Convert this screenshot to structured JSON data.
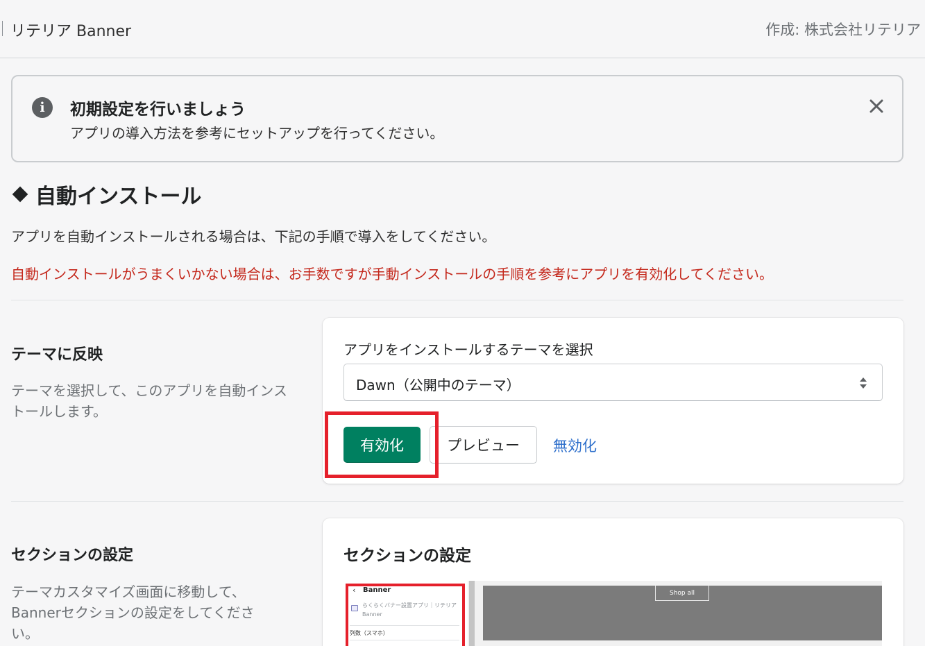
{
  "appbar": {
    "title": "リテリア Banner",
    "author": "作成: 株式会社リテリア"
  },
  "banner": {
    "icon": "info-icon",
    "title": "初期設定を行いましょう",
    "body": "アプリの導入方法を参考にセットアップを行ってください。",
    "close_icon": "close-icon"
  },
  "auto_install": {
    "heading": "自動インストール",
    "description": "アプリを自動インストールされる場合は、下記の手順で導入をしてください。",
    "warning": "自動インストールがうまくいかない場合は、お手数ですが手動インストールの手順を参考にアプリを有効化してください。",
    "warning_color": "#c4281c"
  },
  "theme_section": {
    "title": "テーマに反映",
    "description": "テーマを選択して、このアプリを自動インストールします。",
    "select_label": "アプリをインストールするテーマを選択",
    "select_value": "Dawn（公開中のテーマ）",
    "enable_label": "有効化",
    "preview_label": "プレビュー",
    "disable_label": "無効化",
    "primary_color": "#008060",
    "highlight_color": "#e5202b"
  },
  "section_settings": {
    "title": "セクションの設定",
    "description": "テーマカスタマイズ画面に移動して、Bannerセクションの設定をしてください。",
    "card_title": "セクションの設定",
    "preview": {
      "back_glyph": "‹",
      "panel_title": "Banner",
      "app_name": "らくらくバナー設置アプリ｜リテリア Banner",
      "field_label": "列数（スマホ）",
      "shop_all": "Shop all"
    }
  }
}
